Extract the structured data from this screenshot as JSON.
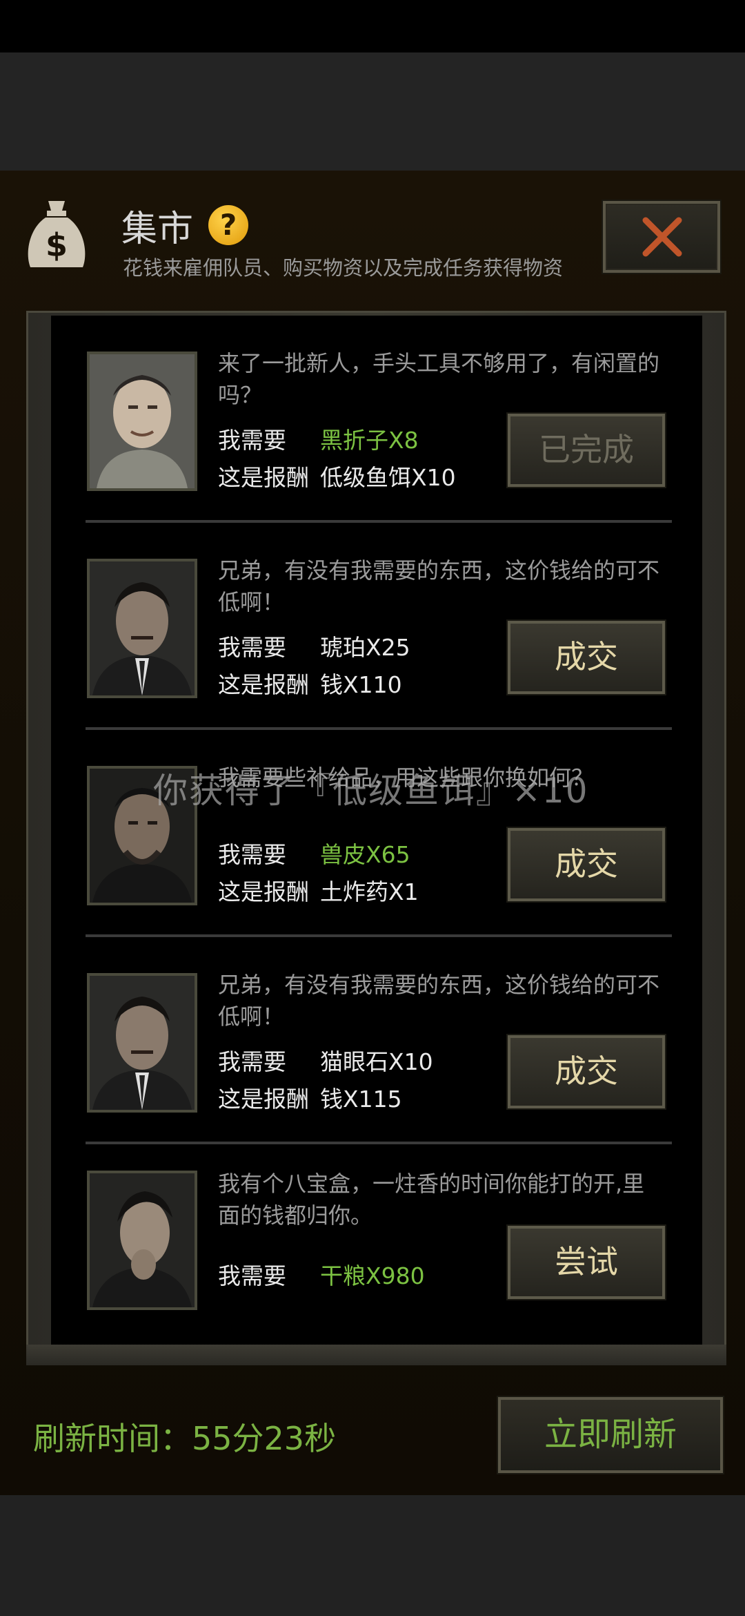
{
  "header": {
    "title": "集市",
    "help_icon": "question-mark",
    "subtitle": "花钱来雇佣队员、购买物资以及完成任务获得物资",
    "close_icon": "x"
  },
  "labels": {
    "need": "我需要",
    "reward": "这是报酬"
  },
  "offers": [
    {
      "quote": "来了一批新人，手头工具不够用了，有闲置的吗？",
      "need": "黑折子X8",
      "reward": "低级鱼饵X10",
      "button": "已完成",
      "state": "completed"
    },
    {
      "quote": "兄弟，有没有我需要的东西，这价钱给的可不低啊！",
      "need": "琥珀X25",
      "reward": "钱X110",
      "button": "成交",
      "state": "available"
    },
    {
      "quote": "我需要些补给品，用这些跟你换如何？",
      "need": "兽皮X65",
      "reward": "土炸药X1",
      "button": "成交",
      "state": "available"
    },
    {
      "quote": "兄弟，有没有我需要的东西，这价钱给的可不低啊！",
      "need": "猫眼石X10",
      "reward": "钱X115",
      "button": "成交",
      "state": "available"
    },
    {
      "quote": "我有个八宝盒，一炷香的时间你能打的开,里面的钱都归你。",
      "need": "干粮X980",
      "button": "尝试",
      "state": "available"
    }
  ],
  "toast": "你获得了『低级鱼饵』×10",
  "footer": {
    "refresh_label": "刷新时间：55分23秒",
    "refresh_button": "立即刷新"
  },
  "colors": {
    "need_green": "#7cc242",
    "button_text": "#e4d7a8",
    "refresh_green": "#7bb343"
  }
}
